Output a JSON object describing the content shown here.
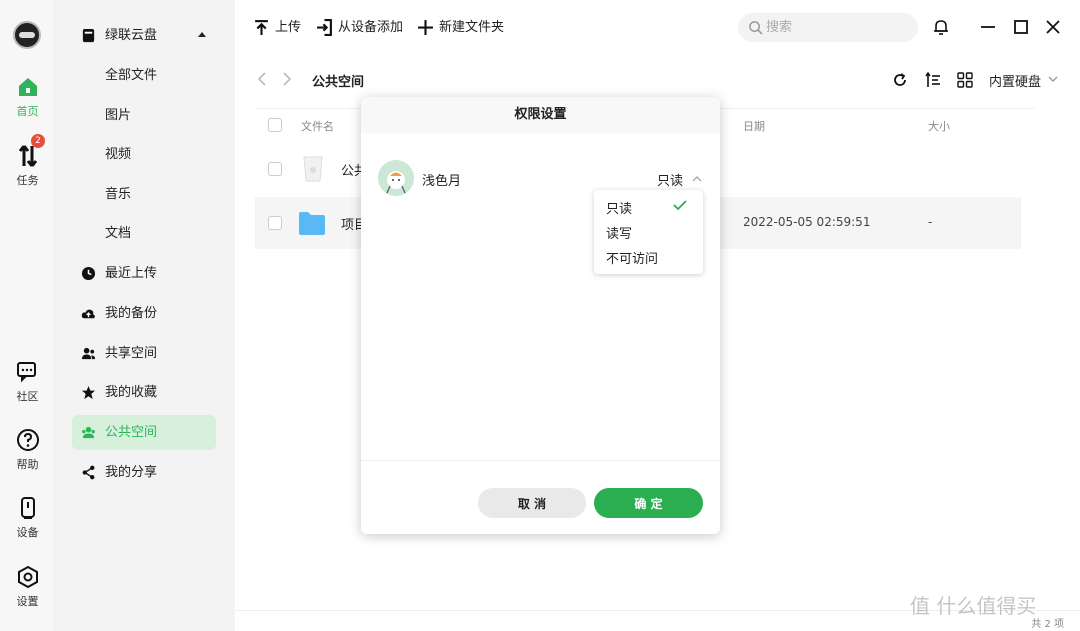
{
  "rail": {
    "items": [
      {
        "label": "首页",
        "icon": "home-icon"
      },
      {
        "label": "任务",
        "icon": "transfer-icon",
        "badge": "2"
      },
      {
        "label": "社区",
        "icon": "community-icon"
      },
      {
        "label": "帮助",
        "icon": "help-icon"
      },
      {
        "label": "设备",
        "icon": "device-icon"
      },
      {
        "label": "设置",
        "icon": "settings-icon"
      }
    ]
  },
  "sidebar": {
    "root": "绿联云盘",
    "items": [
      {
        "label": "全部文件"
      },
      {
        "label": "图片"
      },
      {
        "label": "视频"
      },
      {
        "label": "音乐"
      },
      {
        "label": "文档"
      },
      {
        "label": "最近上传"
      },
      {
        "label": "我的备份"
      },
      {
        "label": "共享空间"
      },
      {
        "label": "我的收藏"
      },
      {
        "label": "公共空间"
      },
      {
        "label": "我的分享"
      }
    ]
  },
  "toolbar": {
    "upload": "上传",
    "add_from_device": "从设备添加",
    "new_folder": "新建文件夹",
    "search_placeholder": "搜索"
  },
  "pathbar": {
    "crumb": "公共空间",
    "disk": "内置硬盘"
  },
  "table": {
    "headers": {
      "name": "文件名",
      "date": "日期",
      "size": "大小"
    },
    "rows": [
      {
        "name": "公共",
        "date": "",
        "size": ""
      },
      {
        "name": "项目",
        "date": "2022-05-05 02:59:51",
        "size": "-"
      }
    ]
  },
  "dialog": {
    "title": "权限设置",
    "user": "浅色月",
    "permission": "只读",
    "cancel": "取 消",
    "confirm": "确 定"
  },
  "dropdown": {
    "options": [
      "只读",
      "读写",
      "不可访问"
    ],
    "selected": "只读"
  },
  "footer": {
    "count": "共 2 项"
  },
  "watermark": "值 什么值得买",
  "colors": {
    "accent": "#2aae4f",
    "active_bg": "#d6f0dc",
    "badge": "#e84c3d",
    "folder": "#5ab8f5"
  }
}
